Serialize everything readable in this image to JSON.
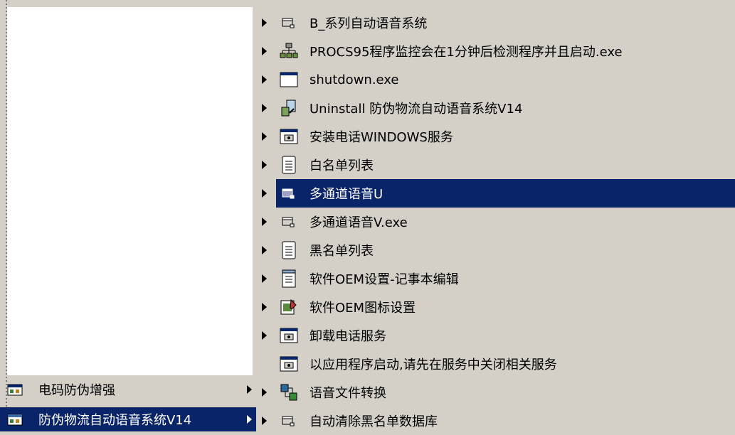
{
  "left_menu": {
    "items": [
      {
        "label": "电码防伪增强",
        "icon": "program-group-icon",
        "selected": false,
        "has_submenu": true
      },
      {
        "label": "防伪物流自动语音系统V14",
        "icon": "program-group-icon",
        "selected": true,
        "has_submenu": true
      }
    ]
  },
  "submenu": {
    "items": [
      {
        "label": "B_系列自动语音系统",
        "icon": "shortcut-icon",
        "has_submenu": true,
        "selected": false
      },
      {
        "label": "PROCS95程序监控会在1分钟后检测程序并且启动.exe",
        "icon": "network-icon",
        "has_submenu": true,
        "selected": false
      },
      {
        "label": "shutdown.exe",
        "icon": "window-icon",
        "has_submenu": true,
        "selected": false
      },
      {
        "label": "Uninstall 防伪物流自动语音系统V14",
        "icon": "uninstall-icon",
        "has_submenu": true,
        "selected": false
      },
      {
        "label": "安装电话WINDOWS服务",
        "icon": "console-icon",
        "has_submenu": true,
        "selected": false
      },
      {
        "label": "白名单列表",
        "icon": "text-file-icon",
        "has_submenu": true,
        "selected": false
      },
      {
        "label": "多通道语音U",
        "icon": "shortcut-icon",
        "has_submenu": true,
        "selected": true
      },
      {
        "label": "多通道语音V.exe",
        "icon": "shortcut-icon",
        "has_submenu": true,
        "selected": false
      },
      {
        "label": "黑名单列表",
        "icon": "text-file-icon",
        "has_submenu": true,
        "selected": false
      },
      {
        "label": "软件OEM设置-记事本编辑",
        "icon": "notepad-icon",
        "has_submenu": true,
        "selected": false
      },
      {
        "label": "软件OEM图标设置",
        "icon": "image-edit-icon",
        "has_submenu": true,
        "selected": false
      },
      {
        "label": "卸载电话服务",
        "icon": "console-icon",
        "has_submenu": true,
        "selected": false
      },
      {
        "label": "以应用程序启动,请先在服务中关闭相关服务",
        "icon": "console-icon",
        "has_submenu": false,
        "selected": false
      },
      {
        "label": "语音文件转换",
        "icon": "converter-icon",
        "has_submenu": true,
        "selected": false
      },
      {
        "label": "自动清除黑名单数据库",
        "icon": "shortcut-icon",
        "has_submenu": true,
        "selected": false
      }
    ]
  },
  "colors": {
    "menu_bg": "#d4d0c8",
    "selection": "#0a246a",
    "selection_text": "#ffffff"
  }
}
